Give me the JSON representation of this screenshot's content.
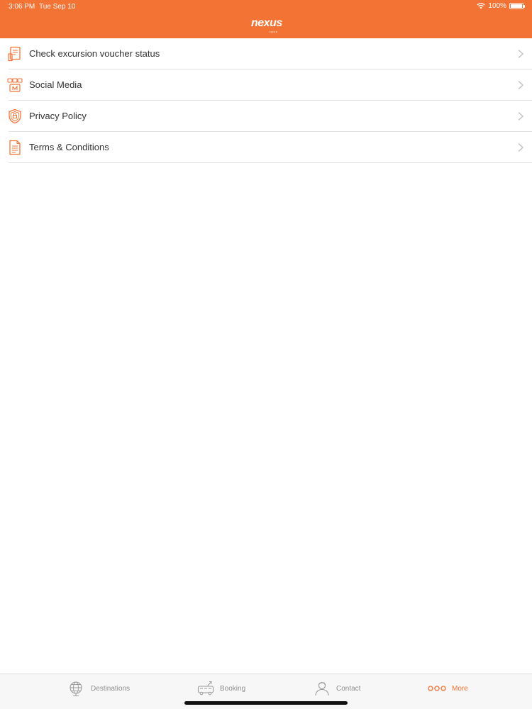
{
  "status_bar": {
    "time": "3:06 PM",
    "date": "Tue Sep 10",
    "battery_text": "100%",
    "battery_level": 1.0
  },
  "header": {
    "logo_text": "nexus",
    "logo_sub": "tours",
    "background_color": "#f37335"
  },
  "menu": {
    "items": [
      {
        "label": "Check excursion voucher status",
        "icon": "voucher-icon"
      },
      {
        "label": "Social Media",
        "icon": "social-media-icon"
      },
      {
        "label": "Privacy Policy",
        "icon": "shield-icon"
      },
      {
        "label": "Terms & Conditions",
        "icon": "document-icon"
      }
    ]
  },
  "tabbar": {
    "tabs": [
      {
        "label": "Destinations",
        "icon": "globe-icon",
        "active": false
      },
      {
        "label": "Booking",
        "icon": "bus-icon",
        "active": false
      },
      {
        "label": "Contact",
        "icon": "person-icon",
        "active": false
      },
      {
        "label": "More",
        "icon": "more-icon",
        "active": true
      }
    ],
    "accent_color": "#f37335",
    "inactive_color": "#8e8e8e"
  }
}
